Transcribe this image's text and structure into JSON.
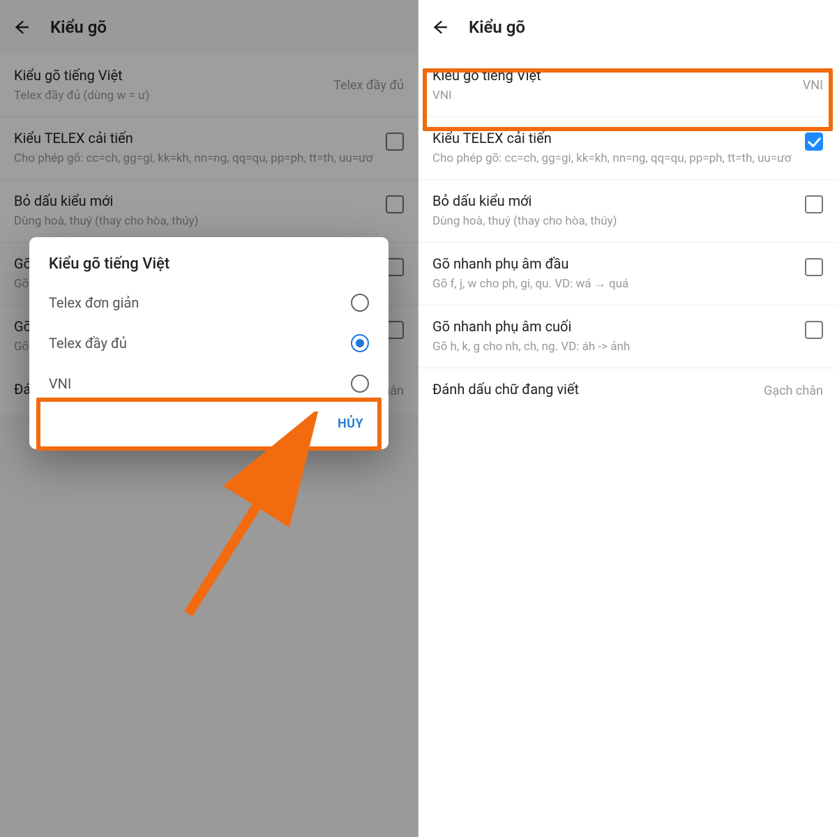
{
  "left": {
    "title": "Kiểu gõ",
    "items": [
      {
        "title": "Kiểu gõ tiếng Việt",
        "sub": "Telex đầy đủ (dùng w = ư)",
        "value": "Telex đầy đủ",
        "control": "value"
      },
      {
        "title": "Kiểu TELEX cải tiến",
        "sub": "Cho phép gõ: cc=ch, gg=gi, kk=kh, nn=ng, qq=qu, pp=ph, tt=th, uu=ươ",
        "control": "checkbox",
        "checked": false
      },
      {
        "title": "Bỏ dấu kiểu mới",
        "sub": "Dùng hoà, thuý (thay cho hòa, thúy)",
        "control": "checkbox",
        "checked": false
      },
      {
        "title": "Gõ nhanh phụ âm đầu",
        "sub": "Gõ f, j, w cho ph, gi, qu. VD: wá → quá",
        "control": "checkbox",
        "checked": false
      },
      {
        "title": "Gõ nhanh phụ âm cuối",
        "sub": "Gõ h, k, g cho nh, ch, ng. VD: áh -> ảnh",
        "control": "checkbox",
        "checked": false
      },
      {
        "title": "Đánh dấu chữ đang viết",
        "sub": "",
        "value": "Gạch chân",
        "control": "value"
      }
    ],
    "dialog": {
      "title": "Kiểu gõ tiếng Việt",
      "options": [
        {
          "label": "Telex đơn giản",
          "selected": false
        },
        {
          "label": "Telex đầy đủ",
          "selected": true
        },
        {
          "label": "VNI",
          "selected": false
        }
      ],
      "cancel": "HỦY"
    }
  },
  "right": {
    "title": "Kiểu gõ",
    "items": [
      {
        "title": "Kiểu gõ tiếng Việt",
        "sub": "VNI",
        "value": "VNI",
        "control": "value"
      },
      {
        "title": "Kiểu TELEX cải tiến",
        "sub": "Cho phép gõ: cc=ch, gg=gi, kk=kh, nn=ng, qq=qu, pp=ph, tt=th, uu=ươ",
        "control": "checkbox",
        "checked": true
      },
      {
        "title": "Bỏ dấu kiểu mới",
        "sub": "Dùng hoà, thuý (thay cho hòa, thúy)",
        "control": "checkbox",
        "checked": false
      },
      {
        "title": "Gõ nhanh phụ âm đầu",
        "sub": "Gõ f, j, w cho ph, gi, qu. VD: wá → quá",
        "control": "checkbox",
        "checked": false
      },
      {
        "title": "Gõ nhanh phụ âm cuối",
        "sub": "Gõ h, k, g cho nh, ch, ng. VD: áh -> ảnh",
        "control": "checkbox",
        "checked": false
      },
      {
        "title": "Đánh dấu chữ đang viết",
        "sub": "",
        "value": "Gạch chân",
        "control": "value"
      }
    ]
  },
  "colors": {
    "accent": "#f26b0f",
    "primary": "#1e77d8"
  }
}
